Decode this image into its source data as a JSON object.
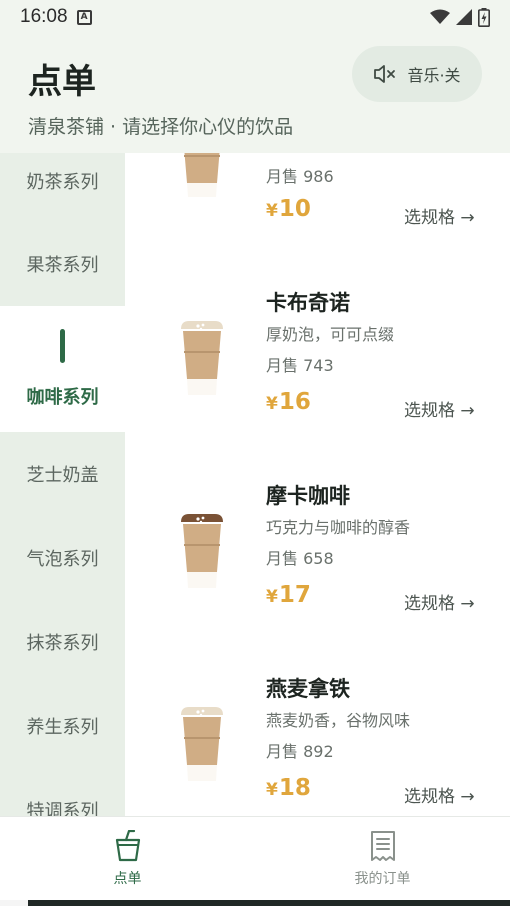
{
  "status_bar": {
    "time": "16:08",
    "notif_glyph": "A"
  },
  "header": {
    "title": "点单",
    "subtitle": "清泉茶铺 · 请选择你心仪的饮品",
    "music_label": "音乐·关"
  },
  "sidebar": {
    "items": [
      {
        "label": "奶茶系列"
      },
      {
        "label": "果茶系列"
      },
      {
        "label": "咖啡系列",
        "active": true
      },
      {
        "label": "芝士奶盖"
      },
      {
        "label": "气泡系列"
      },
      {
        "label": "抹茶系列"
      },
      {
        "label": "养生系列"
      },
      {
        "label": "特调系列"
      }
    ]
  },
  "menu": {
    "items": [
      {
        "name": "",
        "desc": "",
        "sales": "月售 986",
        "price_symbol": "¥",
        "price": "10",
        "spec_label": "选规格 →",
        "lid_color": "#e8dcc8"
      },
      {
        "name": "卡布奇诺",
        "desc": "厚奶泡，可可点缀",
        "sales": "月售 743",
        "price_symbol": "¥",
        "price": "16",
        "spec_label": "选规格 →",
        "lid_color": "#e8dcc8"
      },
      {
        "name": "摩卡咖啡",
        "desc": "巧克力与咖啡的醇香",
        "sales": "月售 658",
        "price_symbol": "¥",
        "price": "17",
        "spec_label": "选规格 →",
        "lid_color": "#7a5236"
      },
      {
        "name": "燕麦拿铁",
        "desc": "燕麦奶香，谷物风味",
        "sales": "月售 892",
        "price_symbol": "¥",
        "price": "18",
        "spec_label": "选规格 →",
        "lid_color": "#e8dcc8"
      }
    ]
  },
  "bottom_nav": {
    "order_label": "点单",
    "my_orders_label": "我的订单"
  },
  "colors": {
    "accent": "#2e6a47",
    "price": "#e0a63c",
    "sidebar_bg": "#e8efe7",
    "header_bg": "#f1f5ef"
  }
}
